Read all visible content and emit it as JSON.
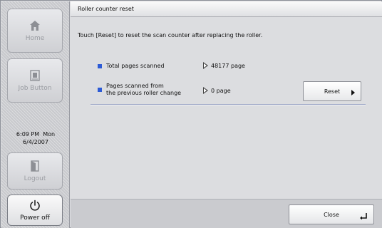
{
  "sidebar": {
    "home_label": "Home",
    "job_button_label": "Job Button",
    "clock_time": "6:09 PM  Mon",
    "clock_date": "6/4/2007",
    "logout_label": "Logout",
    "power_label": "Power off"
  },
  "header": {
    "title": "Roller counter reset"
  },
  "main": {
    "instruction": "Touch [Reset] to reset the scan counter after replacing the roller.",
    "rows": [
      {
        "label": "Total pages scanned",
        "value": "48177 page"
      },
      {
        "label_line1": "Pages scanned from",
        "label_line2": "the previous roller change",
        "value": "0 page"
      }
    ],
    "reset_label": "Reset"
  },
  "footer": {
    "close_label": "Close"
  },
  "icons": {
    "home": "home-icon",
    "job": "job-button-icon",
    "logout": "logout-icon",
    "power": "power-icon"
  },
  "colors": {
    "bullet": "#2d5bd6",
    "separator": "#9ea7c6"
  }
}
